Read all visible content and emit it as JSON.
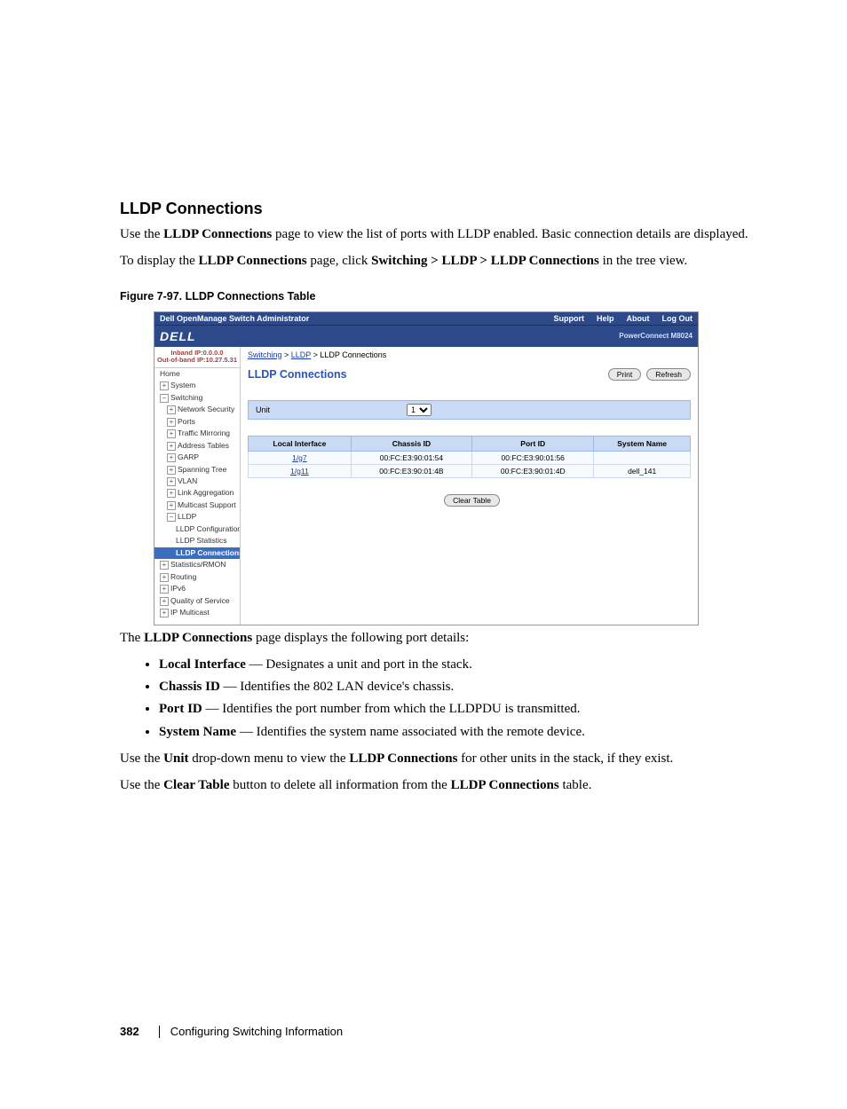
{
  "doc": {
    "heading": "LLDP Connections",
    "intro_part1": "Use the ",
    "intro_bold1": "LLDP Connections",
    "intro_part2": " page to view the list of ports with LLDP enabled. Basic connection details are displayed.",
    "nav_part1": "To display the ",
    "nav_bold1": "LLDP Connections",
    "nav_part2": " page, click ",
    "nav_bold2": "Switching > LLDP > LLDP Connections",
    "nav_part3": " in the tree view.",
    "figure_caption": "Figure 7-97.    LLDP Connections Table",
    "after_fig_part1": "The ",
    "after_fig_bold": "LLDP Connections",
    "after_fig_part2": " page displays the following port details:",
    "details": [
      {
        "term": "Local Interface",
        "desc": " — Designates a unit and port in the stack."
      },
      {
        "term": "Chassis ID",
        "desc": " — Identifies the 802 LAN device's chassis."
      },
      {
        "term": "Port ID",
        "desc": " — Identifies the port number from which the LLDPDU is transmitted."
      },
      {
        "term": "System Name",
        "desc": " — Identifies the system name associated with the remote device."
      }
    ],
    "unit_part1": "Use the ",
    "unit_bold1": "Unit",
    "unit_part2": " drop-down menu to view the ",
    "unit_bold2": "LLDP Connections",
    "unit_part3": " for other units in the stack, if they exist.",
    "clear_part1": "Use the ",
    "clear_bold1": "Clear Table",
    "clear_part2": " button to delete all information from the ",
    "clear_bold2": "LLDP Connections",
    "clear_part3": " table.",
    "footer_page": "382",
    "footer_section": "Configuring Switching Information"
  },
  "screenshot": {
    "topbar": {
      "title": "Dell OpenManage Switch Administrator",
      "links": [
        "Support",
        "Help",
        "About",
        "Log Out"
      ]
    },
    "logo": "DELL",
    "model": "PowerConnect M8024",
    "ip": {
      "inband": "Inband IP:0.0.0.0",
      "outband": "Out-of-band IP:10.27.5.31"
    },
    "tree": [
      {
        "lvl": 1,
        "exp": "",
        "label": "Home"
      },
      {
        "lvl": 1,
        "exp": "+",
        "label": "System"
      },
      {
        "lvl": 1,
        "exp": "−",
        "label": "Switching"
      },
      {
        "lvl": 2,
        "exp": "+",
        "label": "Network Security"
      },
      {
        "lvl": 2,
        "exp": "+",
        "label": "Ports"
      },
      {
        "lvl": 2,
        "exp": "+",
        "label": "Traffic Mirroring"
      },
      {
        "lvl": 2,
        "exp": "+",
        "label": "Address Tables"
      },
      {
        "lvl": 2,
        "exp": "+",
        "label": "GARP"
      },
      {
        "lvl": 2,
        "exp": "+",
        "label": "Spanning Tree"
      },
      {
        "lvl": 2,
        "exp": "+",
        "label": "VLAN"
      },
      {
        "lvl": 2,
        "exp": "+",
        "label": "Link Aggregation"
      },
      {
        "lvl": 2,
        "exp": "+",
        "label": "Multicast Support"
      },
      {
        "lvl": 2,
        "exp": "−",
        "label": "LLDP"
      },
      {
        "lvl": 3,
        "exp": "",
        "label": "LLDP Configuration"
      },
      {
        "lvl": 3,
        "exp": "",
        "label": "LLDP Statistics"
      },
      {
        "lvl": 3,
        "exp": "",
        "label": "LLDP Connections",
        "active": true
      },
      {
        "lvl": 1,
        "exp": "+",
        "label": "Statistics/RMON"
      },
      {
        "lvl": 1,
        "exp": "+",
        "label": "Routing"
      },
      {
        "lvl": 1,
        "exp": "+",
        "label": "IPv6"
      },
      {
        "lvl": 1,
        "exp": "+",
        "label": "Quality of Service"
      },
      {
        "lvl": 1,
        "exp": "+",
        "label": "IP Multicast"
      }
    ],
    "breadcrumb": {
      "a": "Switching",
      "b": "LLDP",
      "c": "LLDP Connections"
    },
    "page_title": "LLDP Connections",
    "buttons": {
      "print": "Print",
      "refresh": "Refresh"
    },
    "unit_label": "Unit",
    "unit_value": "1",
    "table": {
      "headers": [
        "Local Interface",
        "Chassis ID",
        "Port ID",
        "System Name"
      ],
      "rows": [
        {
          "local": "1/g7",
          "chassis": "00:FC:E3:90:01:54",
          "port": "00:FC:E3:90:01:56",
          "sys": ""
        },
        {
          "local": "1/g11",
          "chassis": "00:FC:E3:90:01:4B",
          "port": "00:FC:E3:90:01:4D",
          "sys": "dell_141"
        }
      ]
    },
    "clear_button": "Clear Table"
  }
}
